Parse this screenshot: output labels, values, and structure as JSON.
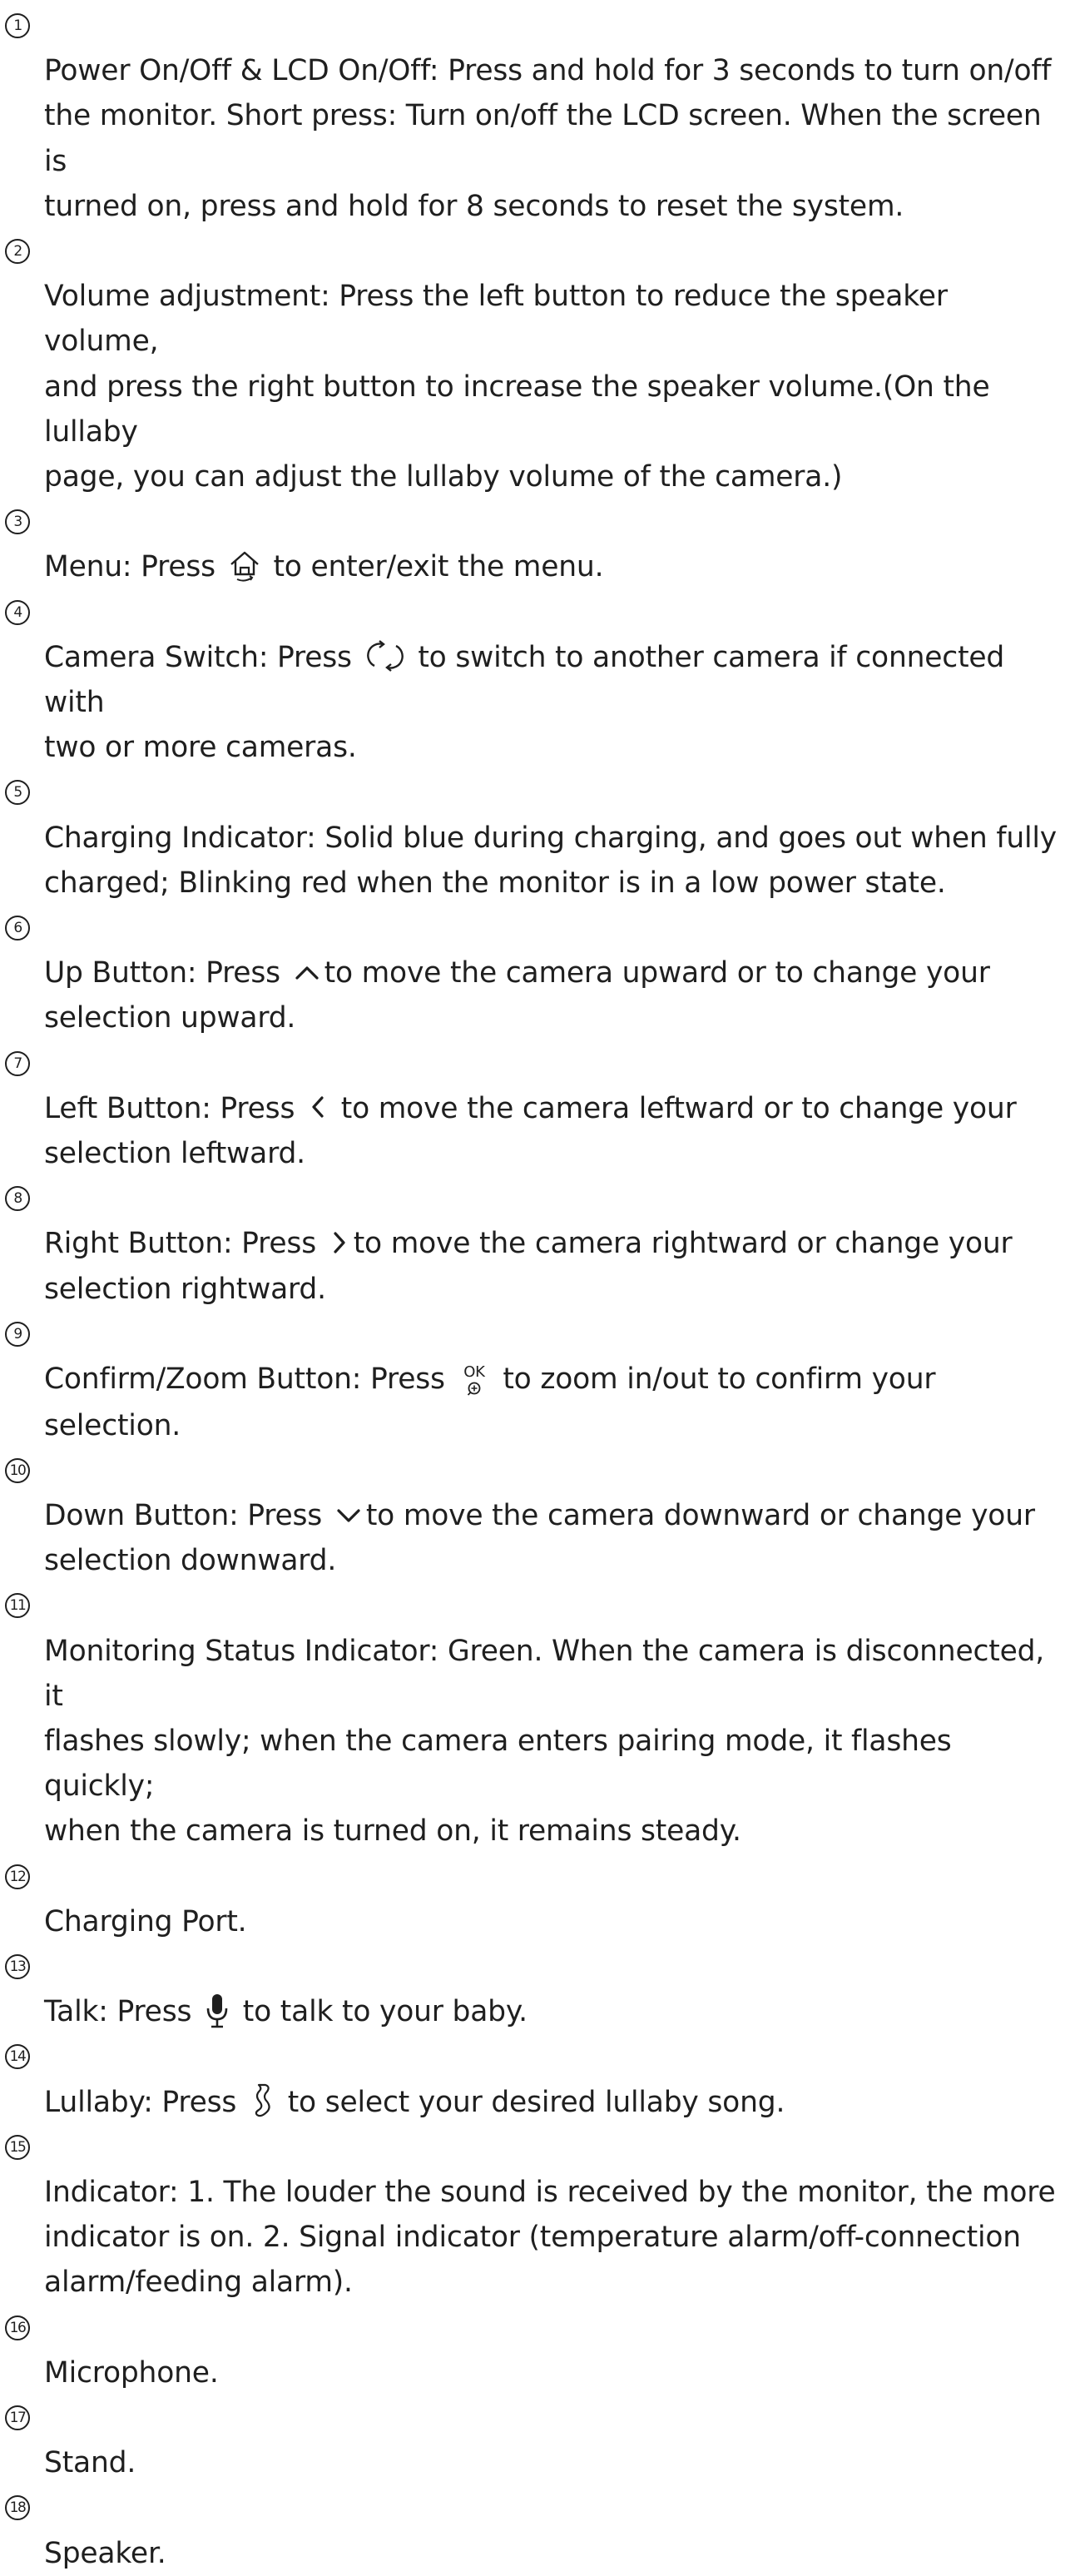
{
  "items": [
    {
      "num": "1",
      "text": "Power On/Off & LCD On/Off: Press and hold for 3 seconds to turn on/off\nthe monitor. Short press: Turn on/off the LCD screen. When the screen is\nturned on, press and hold for 8 seconds to reset the system."
    },
    {
      "num": "2",
      "text": "Volume adjustment: Press the left button to reduce the speaker volume,\nand press the right button to increase the speaker volume.(On the lullaby\n  page, you can adjust the lullaby volume of the camera.)"
    },
    {
      "num": "3",
      "before": "Menu: Press ",
      "icon": "home-icon",
      "after": " to enter/exit the menu."
    },
    {
      "num": "4",
      "before": "Camera Switch:  Press ",
      "icon": "switch-icon",
      "after": " to switch to another camera if connected with\ntwo or more cameras."
    },
    {
      "num": "5",
      "text": "Charging Indicator: Solid blue during charging, and goes out when fully\ncharged; Blinking red when the monitor is in a low power state."
    },
    {
      "num": "6",
      "before": "Up Button: Press ",
      "icon": "chevron-up-icon",
      "after": "to move the camera upward or to change your\nselection upward."
    },
    {
      "num": "7",
      "before": "Left Button: Press ",
      "icon": "chevron-left-icon",
      "after": " to move the camera leftward or to change your\nselection leftward."
    },
    {
      "num": "8",
      "before": "Right Button: Press ",
      "icon": "chevron-right-icon",
      "after": "to move the camera rightward or change your\nselection rightward."
    },
    {
      "num": "9",
      "before": "Confirm/Zoom Button: Press ",
      "icon": "ok-zoom-icon",
      "icon_text": "OK",
      "after": " to zoom in/out to confirm your\nselection."
    },
    {
      "num": "10",
      "before": "Down Button: Press ",
      "icon": "chevron-down-icon",
      "after": "to move the camera downward or change your\nselection downward."
    },
    {
      "num": "11",
      "text": "Monitoring Status Indicator: Green. When the camera is disconnected, it\nflashes slowly; when the camera enters pairing mode, it flashes quickly;\nwhen the camera is turned on, it remains steady."
    },
    {
      "num": "12",
      "text": "Charging Port."
    },
    {
      "num": "13",
      "before": "Talk: Press ",
      "icon": "microphone-icon",
      "after": " to talk to your baby."
    },
    {
      "num": "14",
      "before": "Lullaby: Press ",
      "icon": "lullaby-icon",
      "after": " to select your desired lullaby song."
    },
    {
      "num": "15",
      "text": "Indicator: 1. The louder the sound is received by the monitor, the more\nindicator is on. 2. Signal indicator (temperature alarm/off-connection\nalarm/feeding alarm)."
    },
    {
      "num": "16",
      "text": "Microphone."
    },
    {
      "num": "17",
      "text": "Stand."
    },
    {
      "num": "18",
      "text": "Speaker."
    }
  ]
}
